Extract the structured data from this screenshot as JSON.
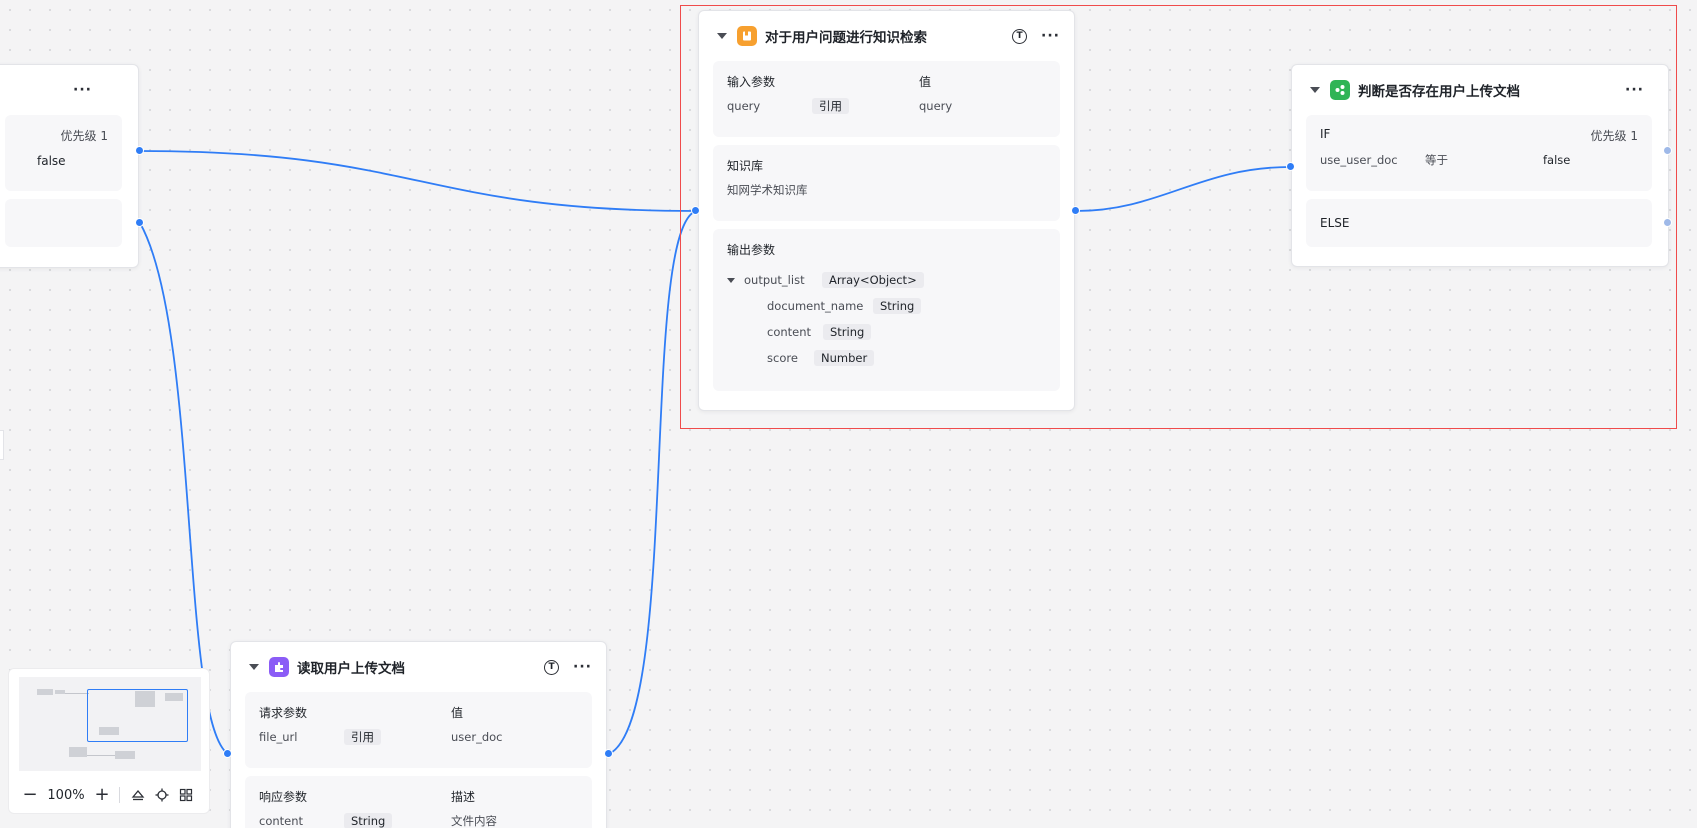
{
  "left_node": {
    "more": "···",
    "priority": "优先级 1",
    "value": "false"
  },
  "knowledge_node": {
    "title": "对于用户问题进行知识检索",
    "t_badge": "T",
    "more": "···",
    "inputs": {
      "header_param": "输入参数",
      "header_value": "值",
      "name": "query",
      "tag": "引用",
      "value": "query"
    },
    "kb": {
      "title": "知识库",
      "value": "知网学术知识库"
    },
    "outputs": {
      "title": "输出参数",
      "items": [
        {
          "name": "output_list",
          "type": "Array<Object>"
        },
        {
          "name": "document_name",
          "type": "String"
        },
        {
          "name": "content",
          "type": "String"
        },
        {
          "name": "score",
          "type": "Number"
        }
      ]
    },
    "icon_color": "#f7a02f"
  },
  "condition_node": {
    "title": "判断是否存在用户上传文档",
    "more": "···",
    "if_label": "IF",
    "priority": "优先级 1",
    "var": "use_user_doc",
    "op": "等于",
    "value": "false",
    "else_label": "ELSE",
    "icon_color": "#2fb455"
  },
  "read_node": {
    "title": "读取用户上传文档",
    "t_badge": "T",
    "more": "···",
    "request": {
      "header_param": "请求参数",
      "header_value": "值",
      "name": "file_url",
      "tag": "引用",
      "value": "user_doc"
    },
    "response": {
      "header_param": "响应参数",
      "header_desc": "描述",
      "name": "content",
      "tag": "String",
      "desc": "文件内容"
    },
    "icon_color": "#8b5cf6"
  },
  "zoom": {
    "minus": "−",
    "value": "100%",
    "plus": "+"
  },
  "accent_color": "#2f7df6",
  "selection_color": "#ef4b4b"
}
